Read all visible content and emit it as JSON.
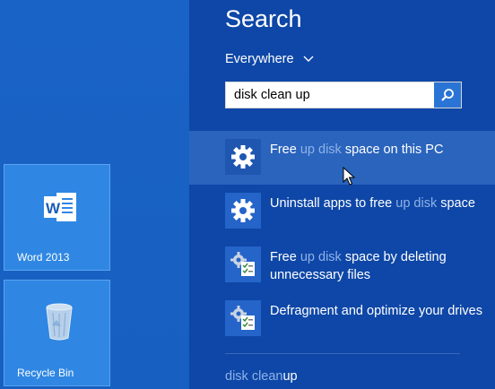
{
  "start": {
    "tiles": [
      {
        "label": "Word 2013",
        "icon": "word-icon"
      },
      {
        "label": "Recycle Bin",
        "icon": "recycle-bin-icon"
      }
    ]
  },
  "search": {
    "title": "Search",
    "scope": "Everywhere",
    "query": "disk clean up",
    "button_icon": "magnifier-icon"
  },
  "results": [
    {
      "icon": "gear-icon",
      "parts": [
        "Free ",
        "up disk",
        " space on this PC"
      ]
    },
    {
      "icon": "gear-icon",
      "parts": [
        "Uninstall apps to free ",
        "up disk",
        " space"
      ]
    },
    {
      "icon": "settings-checklist-icon",
      "parts": [
        "Free ",
        "up disk",
        " space by deleting unnecessary files"
      ]
    },
    {
      "icon": "settings-checklist-icon",
      "parts": [
        "Defragment and optimize your drives",
        "",
        ""
      ]
    }
  ],
  "suggestion": {
    "match": "disk clean",
    "rest": "up"
  },
  "colors": {
    "charm_bg": "#0e47a7",
    "highlight": "#8fb2e8",
    "selected": "#2a64bd",
    "tile": "#2f87e3"
  }
}
